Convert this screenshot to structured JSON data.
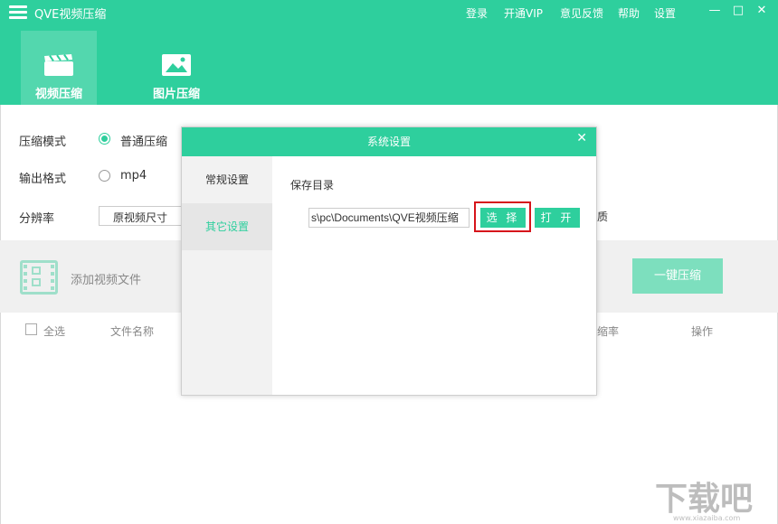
{
  "app": {
    "title": "QVE视频压缩"
  },
  "top_menu": [
    "登录",
    "开通VIP",
    "意见反馈",
    "帮助",
    "设置"
  ],
  "window_controls": {
    "minimize": "—",
    "maximize": "□",
    "close": "✕"
  },
  "tabs": [
    {
      "label": "视频压缩",
      "icon": "clapperboard-icon"
    },
    {
      "label": "图片压缩",
      "icon": "image-icon"
    }
  ],
  "settings": {
    "mode_label": "压缩模式",
    "mode_option": "普通压缩",
    "format_label": "输出格式",
    "format_option": "mp4",
    "resolution_label": "分辨率",
    "resolution_value": "原视频尺寸",
    "quality_partial": "质"
  },
  "file_bar": {
    "add_label": "添加视频文件",
    "compress_button": "一键压缩"
  },
  "columns": {
    "select_all": "全选",
    "file_name": "文件名称",
    "ratio": "缩率",
    "action": "操作"
  },
  "dialog": {
    "title": "系统设置",
    "close": "✕",
    "side_items": [
      "常规设置",
      "其它设置"
    ],
    "save_dir_label": "保存目录",
    "path_value": "s\\pc\\Documents\\QVE视频压缩",
    "choose_button": "选 择",
    "open_button": "打 开"
  },
  "watermark": {
    "text": "下载吧",
    "site": "www.xiazaiba.com"
  },
  "colors": {
    "accent": "#2ecf9d",
    "highlight_box": "#d6141b"
  }
}
